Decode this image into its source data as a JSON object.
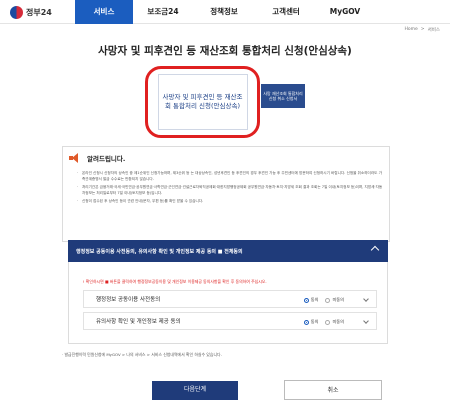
{
  "header": {
    "logo_text": "정부24",
    "nav": [
      {
        "label": "서비스"
      },
      {
        "label": "보조금24"
      },
      {
        "label": "정책정보"
      },
      {
        "label": "고객센터"
      },
      {
        "label": "MyGOV"
      }
    ]
  },
  "breadcrumb": [
    "Home",
    ">",
    "서비스"
  ],
  "page_title": "사망자 및 피후견인 등 재산조회 통합처리 신청(안심상속)",
  "steps": {
    "step1_label": "사망자 및 피후견인 등 재산조회 통합처리 신청(안심상속)",
    "step2_label": "사망 재산조회 통합처리 신청 취소 신청서"
  },
  "notice": {
    "title": "알려드립니다.",
    "items": [
      "온라인 신청시 신청자의 상속인 중 제1순위인 신청가능하며, 제3순위 등 는 대상상속인, 성년후견인 등 후견인의 경우 후견인 가능 후 주민센터에 방문하여 신청하시기 바랍니다. 신청을 취소하더라도 가족관계증명서 발급 수수료는 반환되지 않습니다.",
      "처리기간은 금융거래·국세·국민연금·공무원연금·사학연금·군인연금·건설근로자퇴직공제회·대한지방행정공제회 공무원연금·자동차·토지·지방세 조회 결과 조회는 7일 이내(토지정보 등)이며, 지방세·자동차정보는 처리일로부터 7일 이내(토지정보 등)입니다.",
      "신청이 접수된 후 상속인 등이 관련 안내(문자, 우편 등)를 확인 받을 수 있습니다."
    ]
  },
  "consent": {
    "header": "행정정보 공동이용 사전동의, 유의사항 확인 및 개인정보 제공 동의 ■ 전체동의",
    "warning": "! 확인하시면 ■ 버튼을 클릭하여 행정정보공동이용 및 개인정보 이용제공 동의사항을 확인 후 동의하여 주십시오.",
    "rows": [
      {
        "label": "행정정보 공동이용 사전동의",
        "agree": "동의",
        "disagree": "미동의"
      },
      {
        "label": "유의사항 확인 및 개인정보 제공 동의",
        "agree": "동의",
        "disagree": "미동의"
      }
    ]
  },
  "footnote": "· 발급진행이력 민원신청에 MyGOV > 나의 서비스 > 서비스 신청내역에서 확인 하실수 있습니다.",
  "buttons": {
    "next": "다음단계",
    "cancel": "취소"
  }
}
